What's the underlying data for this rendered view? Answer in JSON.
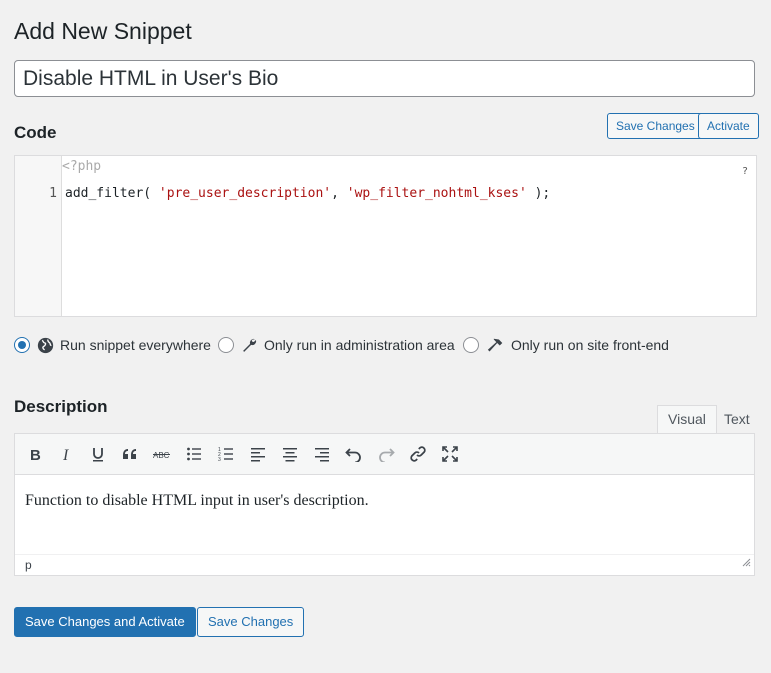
{
  "page": {
    "title": "Add New Snippet"
  },
  "snippet": {
    "title_value": "Disable HTML in User's Bio"
  },
  "code_section": {
    "heading": "Code",
    "save_label": "Save Changes",
    "activate_label": "Activate",
    "php_open": "<?php",
    "help": "?",
    "lines": [
      {
        "number": "1",
        "func": "add_filter(",
        "arg1": "'pre_user_description'",
        "sep": ",",
        "arg2": "'wp_filter_nohtml_kses'",
        "end": ");"
      }
    ]
  },
  "scope": {
    "options": [
      {
        "label": "Run snippet everywhere",
        "icon": "globe-icon",
        "selected": true
      },
      {
        "label": "Only run in administration area",
        "icon": "wrench-icon",
        "selected": false
      },
      {
        "label": "Only run on site front-end",
        "icon": "hammer-icon",
        "selected": false
      }
    ]
  },
  "description": {
    "heading": "Description",
    "tabs": {
      "visual": "Visual",
      "text": "Text",
      "active": "visual"
    },
    "toolbar": [
      "bold-icon",
      "italic-icon",
      "underline-icon",
      "blockquote-icon",
      "strikethrough-icon",
      "bullet-list-icon",
      "numbered-list-icon",
      "align-left-icon",
      "align-center-icon",
      "align-right-icon",
      "undo-icon",
      "redo-icon",
      "link-icon",
      "fullscreen-icon"
    ],
    "content": "Function to disable HTML input in user's description.",
    "path": "p"
  },
  "actions": {
    "save_activate_label": "Save Changes and Activate",
    "save_label": "Save Changes"
  },
  "colors": {
    "accent": "#2271b1",
    "background": "#f1f1f1",
    "string": "#aa1111"
  }
}
